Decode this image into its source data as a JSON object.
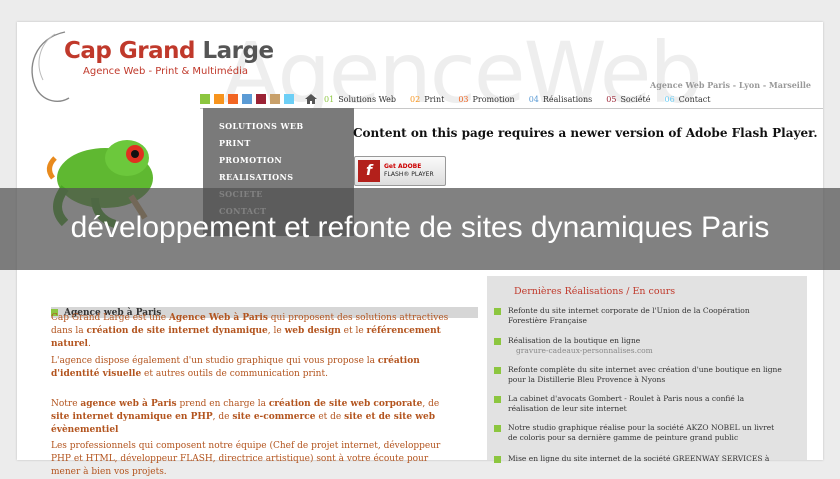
{
  "watermark": "AgenceWeb",
  "logo": {
    "name_red": "Cap Grand",
    "name_grey": "Large",
    "tagline": "Agence Web - Print & Multimédia"
  },
  "top_right": "Agence Web Paris - Lyon - Marseille",
  "swatch_colors": [
    "#8cc63f",
    "#f7941d",
    "#f26522",
    "#5b9bd5",
    "#9b2335",
    "#c8a06a",
    "#6dcff6"
  ],
  "nav": [
    {
      "num": "01",
      "label": "Solutions Web",
      "color": "#8cc63f"
    },
    {
      "num": "02",
      "label": "Print",
      "color": "#f7941d"
    },
    {
      "num": "03",
      "label": "Promotion",
      "color": "#f26522"
    },
    {
      "num": "04",
      "label": "Réalisations",
      "color": "#5b9bd5"
    },
    {
      "num": "05",
      "label": "Société",
      "color": "#9b2335"
    },
    {
      "num": "06",
      "label": "Contact",
      "color": "#6dcff6"
    }
  ],
  "menu": [
    "SOLUTIONS WEB",
    "PRINT",
    "PROMOTION",
    "REALISATIONS",
    "SOCIETE",
    "CONTACT"
  ],
  "flash": {
    "message": "Content on this page requires a newer version of Adobe Flash Player.",
    "btn_line1": "Get ADOBE",
    "btn_line2": "FLASH® PLAYER"
  },
  "band_title": "développement et refonte de sites dynamiques Paris",
  "left": {
    "heading": "Agence web à Paris",
    "p1a": "Cap Grand Large est une ",
    "p1b": "Agence Web à Paris",
    "p1c": " qui proposent des solutions attractives dans la ",
    "p1d": "création de site internet dynamique",
    "p1e": ", le ",
    "p1f": "web design",
    "p1g": " et le ",
    "p1h": "référencement naturel",
    "p1i": ".",
    "p2a": "L'agence dispose également d'un studio graphique qui vous propose la ",
    "p2b": "création d'identité visuelle",
    "p2c": " et autres outils de communication print.",
    "p3a": "Notre ",
    "p3b": "agence web à Paris",
    "p3c": " prend en charge la ",
    "p3d": "création de site web corporate",
    "p3e": ", de ",
    "p3f": "site internet dynamique en PHP",
    "p3g": ", de ",
    "p3h": "site e-commerce",
    "p3i": " et de ",
    "p3j": "site et de site web évènementiel",
    "p4": "Les professionnels qui composent notre équipe (Chef de projet internet, développeur PHP et HTML, développeur FLASH, directrice artistique) sont à votre écoute pour mener à bien vos projets."
  },
  "right": {
    "heading": "Dernières Réalisations / En cours",
    "items": [
      {
        "text": "Refonte du site internet corporate de l'Union de la Coopération Forestière Française",
        "sub": ""
      },
      {
        "text": "Réalisation de la boutique en ligne",
        "sub": "gravure-cadeaux-personnalises.com"
      },
      {
        "text": "Refonte complète du site internet avec création d'une boutique en ligne pour la Distillerie Bleu Provence à Nyons",
        "sub": ""
      },
      {
        "text": "La cabinet d'avocats Gombert - Roulet à Paris nous a confié la réalisation de leur site internet",
        "sub": ""
      },
      {
        "text": "Notre studio graphique réalise pour la société AKZO NOBEL un livret de coloris pour sa dernière gamme de peinture grand public",
        "sub": ""
      },
      {
        "text": "Mise en ligne du site internet de la société GREENWAY SERVICES à",
        "sub": ""
      }
    ]
  }
}
